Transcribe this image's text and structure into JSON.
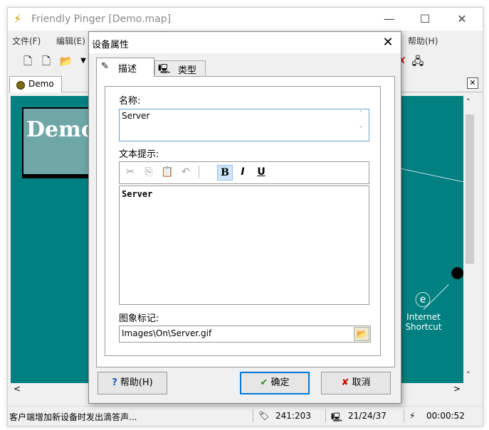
{
  "window": {
    "title": "Friendly Pinger [Demo.map]",
    "controls": {
      "minimize": "—",
      "maximize": "☐",
      "close": "✕"
    }
  },
  "menubar": {
    "items": [
      "文件(F)",
      "编辑(E)",
      "帮助(H)"
    ]
  },
  "toolbar": {
    "left_icons": [
      "new-map-icon",
      "new-document-icon",
      "open-folder-icon",
      "dropdown-arrow-icon"
    ],
    "right_icons": [
      "ping-icon",
      "network-icon"
    ]
  },
  "doc_tab": {
    "label": "Demo",
    "close": "✕"
  },
  "map": {
    "title_text": "Demo",
    "internet_shortcut_label": "Internet\nShortcut"
  },
  "scroll": {
    "up": "˄",
    "down": "˅",
    "left": "<",
    "right": ">"
  },
  "statusbar": {
    "message": "客户端增加新设备时发出滴答声...",
    "coords": "241:203",
    "counts": "21/24/37",
    "timer": "00:00:52"
  },
  "dialog": {
    "title": "设备属性",
    "close": "✕",
    "tabs": [
      {
        "label": "描述",
        "icon": "pencil-doc-icon",
        "active": true
      },
      {
        "label": "类型",
        "icon": "computer-icon",
        "active": false
      }
    ],
    "name_label": "名称:",
    "name_value": "Server",
    "tooltip_label": "文本提示:",
    "format_buttons": [
      "cut-icon",
      "copy-icon",
      "paste-icon",
      "undo-icon",
      "bold-icon",
      "italic-icon",
      "underline-icon"
    ],
    "format_labels": {
      "bold": "B",
      "italic": "I",
      "underline": "U"
    },
    "tooltip_value": "Server",
    "image_label": "图象标记:",
    "image_value": "Images\\On\\Server.gif",
    "buttons": {
      "help": "帮助(H)",
      "ok": "确定",
      "cancel": "取消"
    }
  }
}
